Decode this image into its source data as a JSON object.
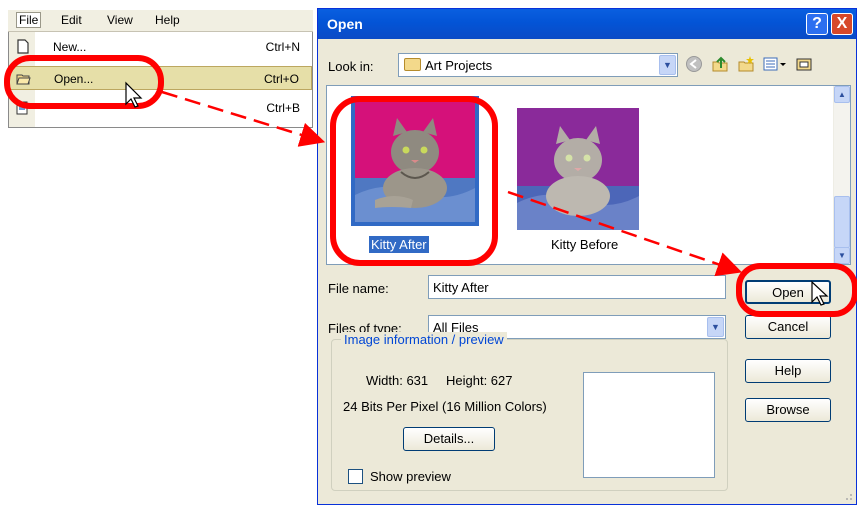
{
  "menu": {
    "bar": [
      {
        "label": "File"
      },
      {
        "label": "Edit"
      },
      {
        "label": "View"
      },
      {
        "label": "Help"
      }
    ],
    "items": [
      {
        "label": "New...",
        "shortcut": "Ctrl+N",
        "icon": "new-document-icon"
      },
      {
        "label": "Open...",
        "shortcut": "Ctrl+O",
        "icon": "open-folder-icon",
        "selected": true
      },
      {
        "label": "",
        "shortcut": "Ctrl+B",
        "icon": "browse-icon"
      }
    ]
  },
  "dialog": {
    "title": "Open",
    "title_help": "?",
    "title_close": "X",
    "look_in_label": "Look in:",
    "look_in_value": "Art Projects",
    "files": [
      {
        "name": "Kitty After",
        "selected": true
      },
      {
        "name": "Kitty Before",
        "selected": false
      }
    ],
    "file_name_label": "File name:",
    "file_name_value": "Kitty After",
    "files_of_type_label": "Files of type:",
    "files_of_type_value": "All Files",
    "buttons": {
      "open": "Open",
      "cancel": "Cancel",
      "help": "Help",
      "browse": "Browse"
    },
    "image_info": {
      "title": "Image information / preview",
      "width_text": "Width: 631",
      "height_text": "Height: 627",
      "bits_text": "24 Bits Per Pixel (16 Million Colors)",
      "details_button": "Details...",
      "show_preview_label": "Show preview",
      "show_preview_checked": false
    }
  },
  "colors": {
    "highlight": "#ff0000",
    "xp_title_blue": "#0354d6",
    "selection_blue": "#316ac5",
    "dialog_face": "#ece9d8"
  }
}
